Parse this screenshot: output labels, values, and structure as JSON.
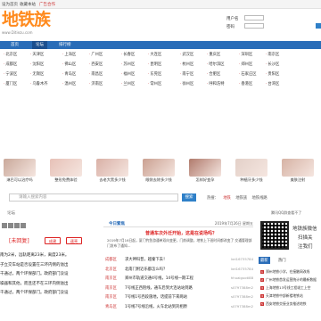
{
  "topbar": {
    "set_home": "设为首页",
    "bookmark": "收藏本站",
    "ad": "广告合作"
  },
  "logo": {
    "title": "地铁族",
    "domain": "www.Ditiezu.com"
  },
  "login": {
    "user_label": "用户名",
    "pass_label": "密码"
  },
  "nav": {
    "items": [
      "首页",
      "论坛",
      "排行榜"
    ]
  },
  "regions": [
    [
      "北京区",
      "天津区",
      "上海区",
      "广州区",
      "长春区",
      "大连区",
      "武汉区",
      "重庆区",
      "深圳区",
      "南京区"
    ],
    [
      "成都区",
      "沈阳区",
      "佛山区",
      "西安区",
      "苏州区",
      "昆明区",
      "杭州区",
      "哈尔滨区",
      "郑州区",
      "长沙区"
    ],
    [
      "宁波区",
      "无锡区",
      "青岛区",
      "南昌区",
      "福州区",
      "东莞区",
      "南宁区",
      "合肥区",
      "石家庄区",
      "贵阳区"
    ],
    [
      "厦门区",
      "乌鲁木齐",
      "温州区",
      "济南区",
      "兰州区",
      "常州区",
      "徐州区",
      "呼和浩特",
      "香港区",
      "台湾区"
    ]
  ],
  "thumbs": [
    "淋巴可以治疗吗",
    "整形免费体验",
    "去老大黑多少钱",
    "眼袋去除多少钱",
    "怎样好变孕",
    "种植牙多少钱",
    "美肤注射"
  ],
  "search": {
    "placeholder": "请输入搜索内容",
    "button": "搜索",
    "hot_label": "热搜：",
    "hot": [
      "地铁",
      "地铁族",
      "地铁线路"
    ]
  },
  "qq_link": "腾讯QQ群查看不了",
  "breadcrumb": "论坛",
  "post": {
    "title": "[未回复]",
    "btn_reply": "成建",
    "btn_new": "速壳",
    "body": "南为2米，远轨距离23米，离度23米。\n子立交车站是否设置在三环内侧的溢出\n千通过，两个环保部门。政府部门没设\n噪器和其他，而且还不在三环内侧溢出\n千通过，两个环保部门。政府部门没设"
  },
  "mid": {
    "title": "今日繁焦",
    "date": "2019年7月26日 星期五",
    "feature_title": "普通车次外迁开始，这是在说场吗？",
    "feature_desc": "2019年7月16日起，厦门钓鱼游通单双向变更，门前调整，地铁上下班时间都改变了\n交通管理部门发布了通知...",
    "rows": [
      {
        "tag": "成都区",
        "text": "求大神科普，越秦下去！",
        "by": "kei16735784"
      },
      {
        "tag": "北京区",
        "text": "北南门附近乐都怎么吗？",
        "by": "kei16735784"
      },
      {
        "tag": "南京区",
        "text": "郑州市轨道交通4号线，14号线一期工程",
        "by": "hhuaiguoti88"
      },
      {
        "tag": "南京区",
        "text": "7号线正西阻线，通车后到大连站站到路",
        "by": "s0797388m2"
      },
      {
        "tag": "南京区",
        "text": "7号线1号西段施地，话提前下来两站",
        "by": "s0797388m2"
      },
      {
        "tag": "青岛区",
        "text": "1号线7号线沿线，火车北站到刘相原",
        "by": "s0797388m2"
      }
    ]
  },
  "right": {
    "qr_line1": "地铁族微信",
    "qr_line2": "扫描关",
    "qr_line3": "注我们",
    "tabs": [
      "最新",
      "热门"
    ],
    "list": [
      "郑州地铁小学，在接触网改线",
      "广州地铁首发运营统计的最新数据",
      "上海地铁13号线工程竣工上空",
      "天津地铁中部新楼地铁站",
      "西安地铁交接业务推进地铁"
    ]
  }
}
